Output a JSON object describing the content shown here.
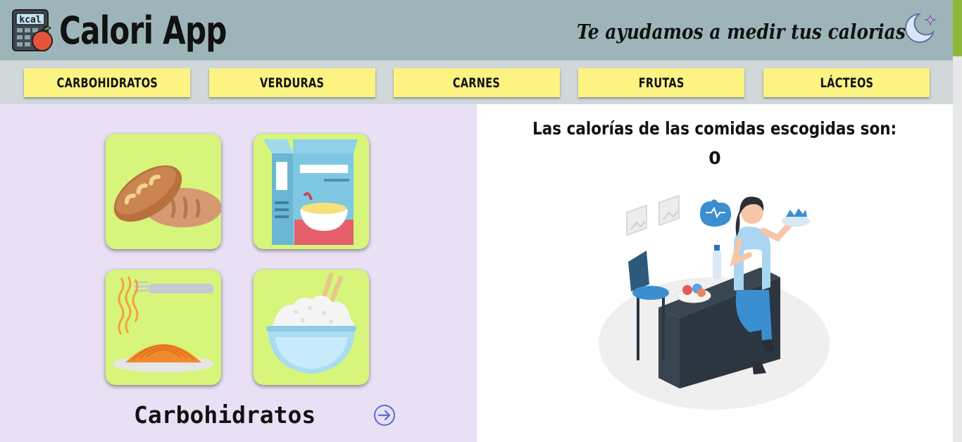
{
  "header": {
    "logo_icon": "calculator-apple-icon",
    "logo_text": "kcal",
    "title": "Calori App",
    "tagline": "Te ayudamos a medir tus calorias",
    "moon_icon": "crescent-moon-star-icon",
    "background": "#9db5b9"
  },
  "nav": {
    "items": [
      {
        "label": "CARBOHIDRATOS"
      },
      {
        "label": "VERDURAS"
      },
      {
        "label": "CARNES"
      },
      {
        "label": "FRUTAS"
      },
      {
        "label": "LÁCTEOS"
      }
    ],
    "button_color": "#fdf382"
  },
  "food_panel": {
    "tiles": [
      {
        "icon": "bread-icon"
      },
      {
        "icon": "cereal-box-icon"
      },
      {
        "icon": "spaghetti-icon"
      },
      {
        "icon": "rice-bowl-icon"
      }
    ],
    "tile_color": "#d7f57a",
    "category": "Carbohidratos",
    "next_icon": "arrow-right-circle-icon",
    "background": "#e9e0f5"
  },
  "calories": {
    "heading": "Las calorías de las comidas escogidas son:",
    "value": "0",
    "illustration": "woman-eating-salad-illustration"
  }
}
